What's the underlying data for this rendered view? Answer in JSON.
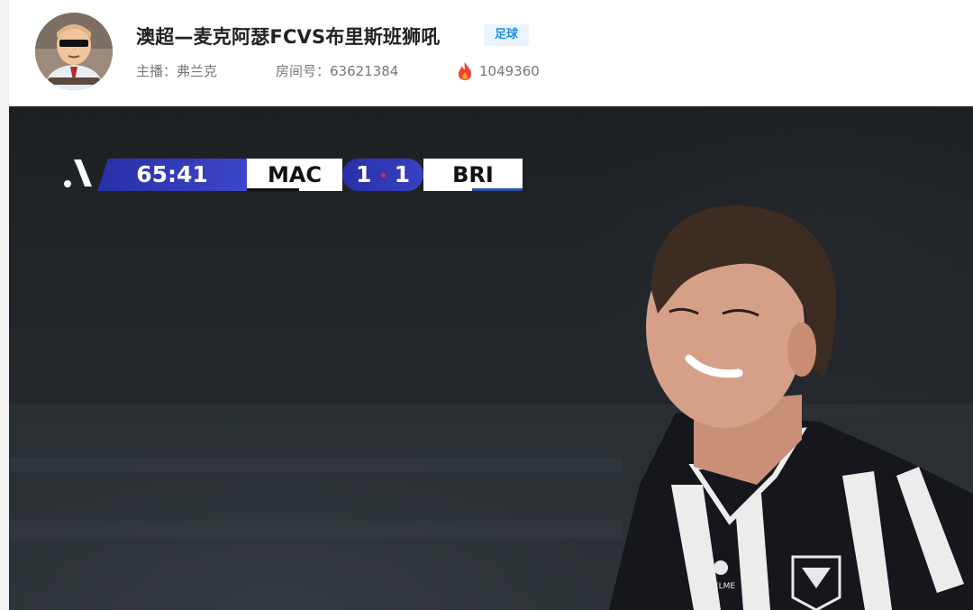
{
  "header": {
    "title": "澳超—麦克阿瑟FCVS布里斯班狮吼",
    "category_tag": "足球",
    "streamer_label": "主播：弗兰克",
    "room_label": "房间号：63621384",
    "popularity": "1049360",
    "popularity_icon": "flame-icon",
    "tag_color": "#1f8fe6"
  },
  "scoreboard": {
    "time": "65:41",
    "home_team": "MAC",
    "home_score": "1",
    "away_score": "1",
    "away_team": "BRI",
    "accent_color": "#2830a8"
  }
}
